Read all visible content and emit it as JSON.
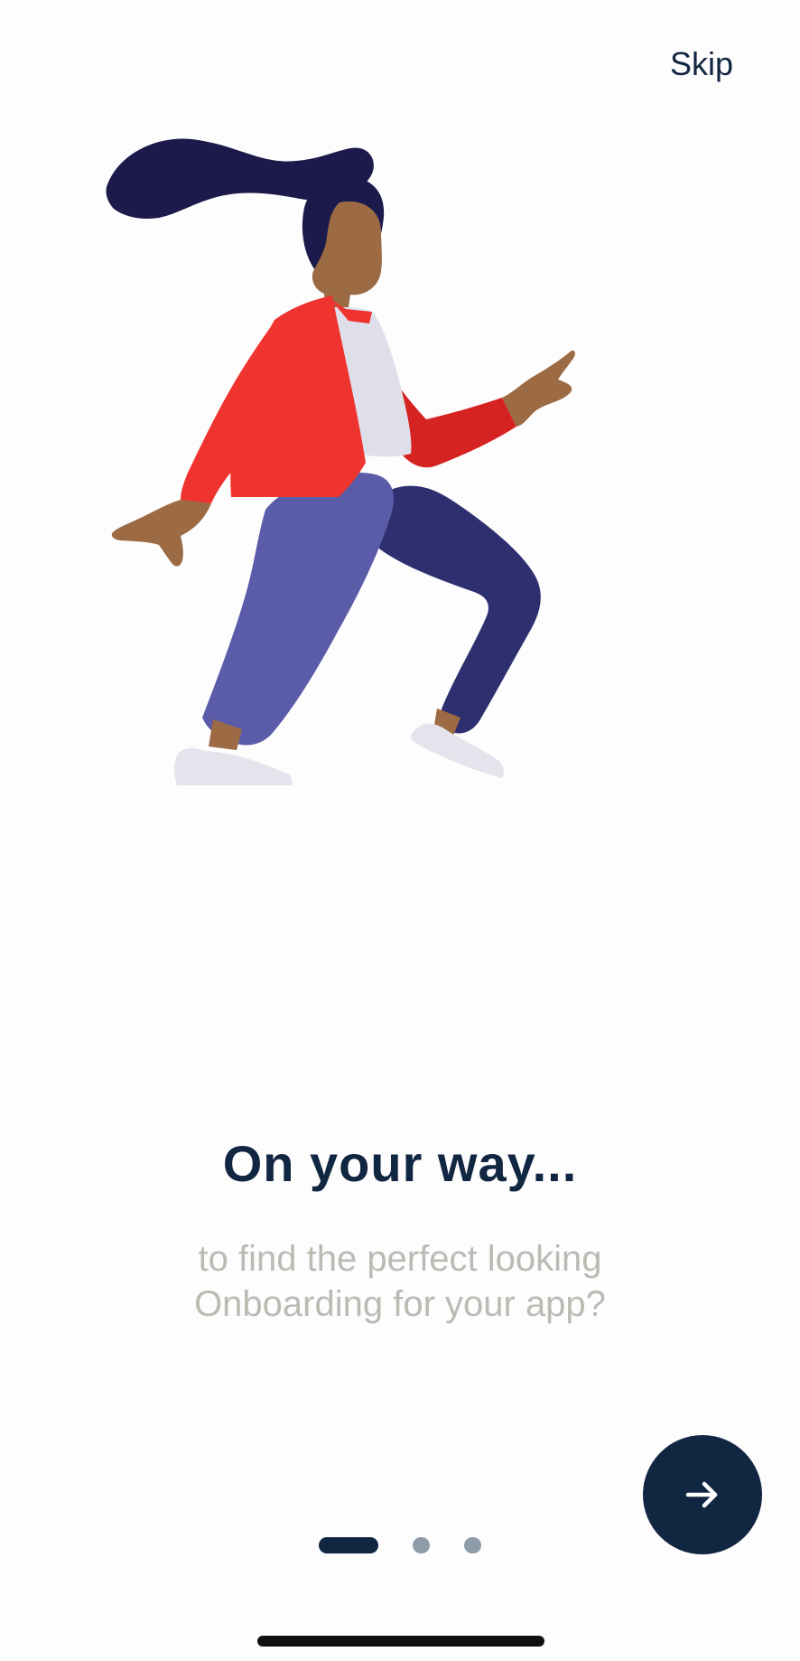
{
  "header": {
    "skip_label": "Skip"
  },
  "main": {
    "title": "On your way...",
    "subtitle": "to find the perfect looking\nOnboarding for your app?"
  },
  "footer": {
    "next_icon": "arrow-right-icon",
    "pager": {
      "page_count": 3,
      "current_page": 1
    }
  },
  "illustration": {
    "semantic_name": "walking-woman-illustration"
  },
  "colors": {
    "background": "#fefdfe",
    "primary": "#102641",
    "subtitle": "#bdbab4",
    "inactive_dot": "#8e9caa",
    "jacket": "#ef3430",
    "pants_front": "#5b5ca9",
    "pants_back": "#2d2f6e",
    "hair": "#1b1a4a",
    "skin": "#9c6a43",
    "shirt": "#dedfe9",
    "shoe": "#e5e3ec"
  }
}
